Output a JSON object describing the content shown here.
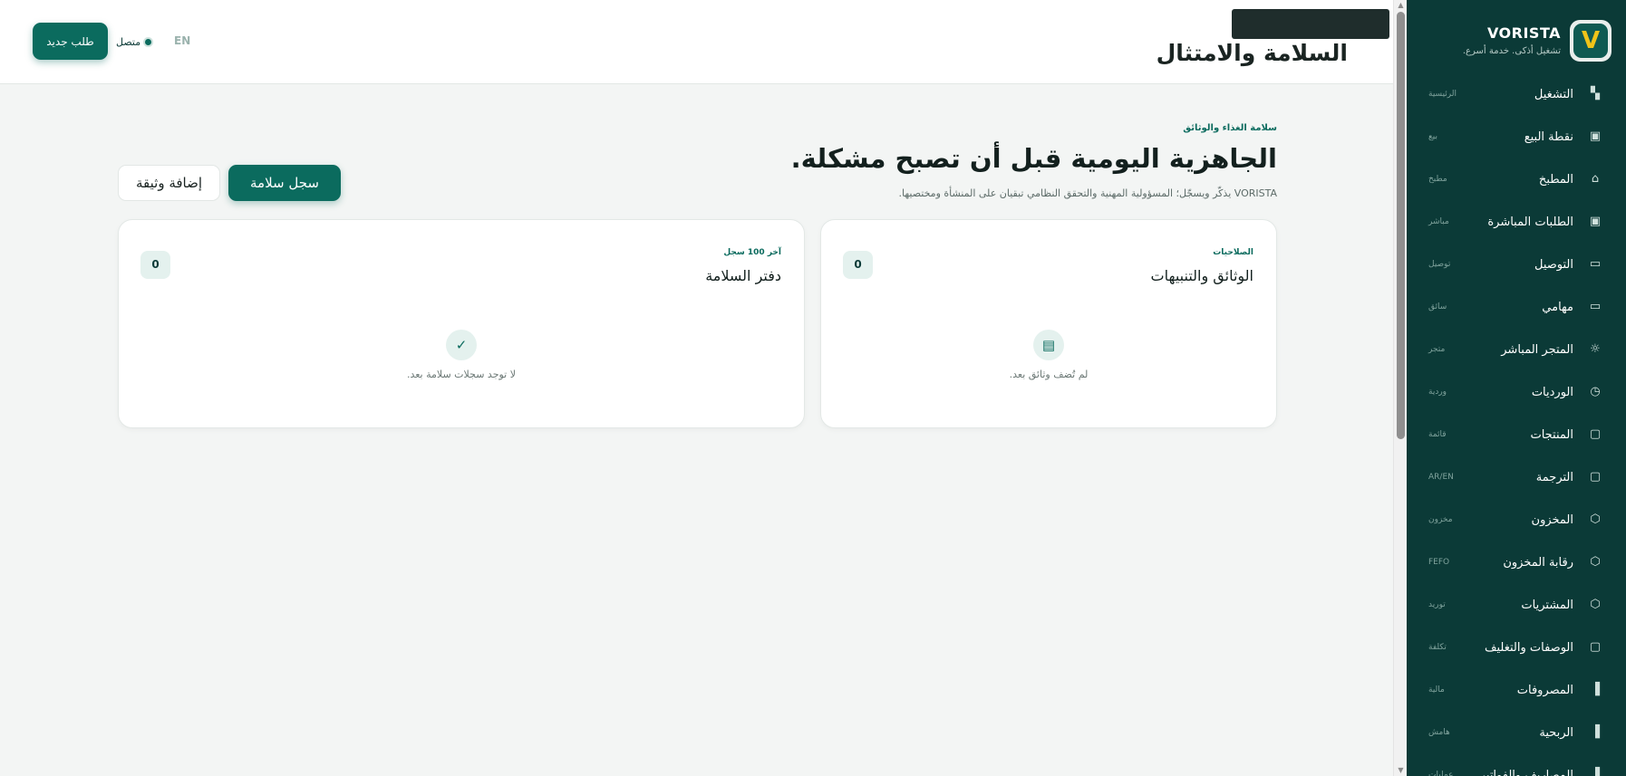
{
  "brand": {
    "logo_letter": "V",
    "name": "VORISTA",
    "tagline": "تشغيل أذكى. خدمة أسرع."
  },
  "sidebar": {
    "items": [
      {
        "label": "التشغيل",
        "badge": "الرئيسية",
        "icon": "dashboard-icon",
        "glyph": "▚"
      },
      {
        "label": "نقطة البيع",
        "badge": "بيع",
        "icon": "pos-icon",
        "glyph": "▣"
      },
      {
        "label": "المطبخ",
        "badge": "مطبخ",
        "icon": "kitchen-icon",
        "glyph": "⌂"
      },
      {
        "label": "الطلبات المباشرة",
        "badge": "مباشر",
        "icon": "live-orders-icon",
        "glyph": "▣"
      },
      {
        "label": "التوصيل",
        "badge": "توصيل",
        "icon": "delivery-icon",
        "glyph": "▭"
      },
      {
        "label": "مهامي",
        "badge": "سائق",
        "icon": "tasks-icon",
        "glyph": "▭"
      },
      {
        "label": "المتجر المباشر",
        "badge": "متجر",
        "icon": "store-icon",
        "glyph": "☼"
      },
      {
        "label": "الورديات",
        "badge": "وردية",
        "icon": "shifts-icon",
        "glyph": "◷"
      },
      {
        "label": "المنتجات",
        "badge": "قائمة",
        "icon": "products-icon",
        "glyph": "▢"
      },
      {
        "label": "الترجمة",
        "badge": "AR/EN",
        "icon": "translation-icon",
        "glyph": "▢"
      },
      {
        "label": "المخزون",
        "badge": "مخزون",
        "icon": "inventory-icon",
        "glyph": "⬡"
      },
      {
        "label": "رقابة المخزون",
        "badge": "FEFO",
        "icon": "inventory-control-icon",
        "glyph": "⬡"
      },
      {
        "label": "المشتريات",
        "badge": "توريد",
        "icon": "purchases-icon",
        "glyph": "⬡"
      },
      {
        "label": "الوصفات والتغليف",
        "badge": "تكلفة",
        "icon": "recipes-icon",
        "glyph": "▢"
      },
      {
        "label": "المصروفات",
        "badge": "مالية",
        "icon": "expenses-icon",
        "glyph": "▐"
      },
      {
        "label": "الربحية",
        "badge": "هامش",
        "icon": "profitability-icon",
        "glyph": "▐"
      },
      {
        "label": "المصاريف والفواتير",
        "badge": "عمليات",
        "icon": "bills-icon",
        "glyph": "▐"
      }
    ]
  },
  "header": {
    "title": "السلامة والامتثال",
    "new_order": "طلب جديد",
    "status": "متصل",
    "lang": "EN"
  },
  "main": {
    "eyebrow": "سلامة الغذاء والوثائق",
    "title": "الجاهزية اليومية قبل أن تصبح مشكلة.",
    "subtitle": "VORISTA يذكّر ويسجّل؛ المسؤولية المهنية والتحقق النظامي تبقيان على المنشأة ومختصيها.",
    "primary_button": "سجل سلامة",
    "secondary_button": "إضافة وثيقة"
  },
  "cards": {
    "documents": {
      "eyebrow": "الصلاحيات",
      "title": "الوثائق والتنبيهات",
      "count": "0",
      "empty_glyph": "▤",
      "empty_text": "لم تُضف وثائق بعد."
    },
    "safety_log": {
      "eyebrow": "آخر 100 سجل",
      "title": "دفتر السلامة",
      "count": "0",
      "empty_glyph": "✓",
      "empty_text": "لا توجد سجلات سلامة بعد."
    }
  },
  "colors": {
    "sidebar_bg": "#0b3a37",
    "accent": "#0b6b5e",
    "logo_gold": "#f0c419"
  }
}
